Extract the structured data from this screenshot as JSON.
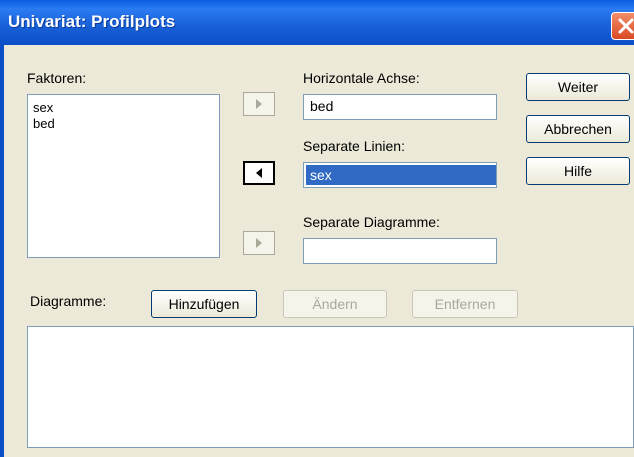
{
  "window": {
    "title": "Univariat: Profilplots"
  },
  "factors": {
    "label": "Faktoren:",
    "items": [
      "sex",
      "bed"
    ]
  },
  "horizontal_axis": {
    "label": "Horizontale Achse:",
    "value": "bed"
  },
  "separate_lines": {
    "label": "Separate Linien:",
    "value": "sex"
  },
  "separate_diagrams": {
    "label": "Separate Diagramme:",
    "value": ""
  },
  "buttons": {
    "continue": "Weiter",
    "cancel": "Abbrechen",
    "help": "Hilfe"
  },
  "diagrams": {
    "label": "Diagramme:",
    "add": "Hinzufügen",
    "change": "Ändern",
    "remove": "Entfernen"
  },
  "icons": {
    "close": "close-icon",
    "arrow_right": "arrow-right-icon",
    "arrow_left": "arrow-left-icon"
  },
  "colors": {
    "titlebar": "#0b4ec8",
    "selection": "#316ac5",
    "dialog_bg": "#ece9d8",
    "close": "#d94a22"
  }
}
